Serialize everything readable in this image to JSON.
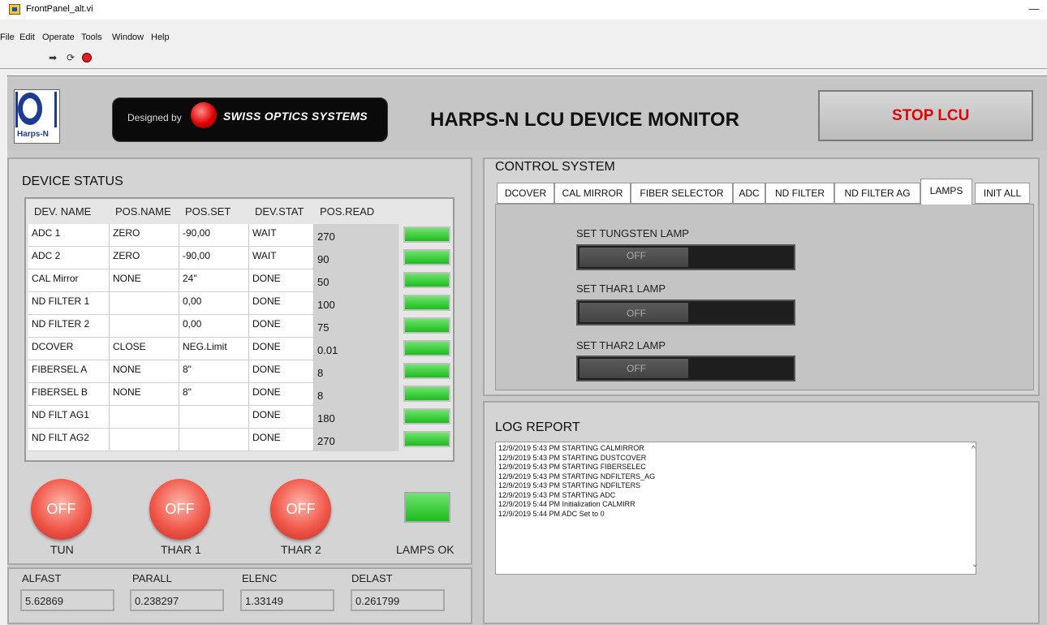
{
  "window": {
    "title": "FrontPanel_alt.vi",
    "minimize": "—"
  },
  "menu": [
    "File",
    "Edit",
    "Operate",
    "Tools",
    "Window",
    "Help"
  ],
  "toolbar": {
    "run_icon": "run-arrow-icon",
    "continuous_icon": "run-continuous-icon",
    "abort_icon": "abort-icon"
  },
  "header": {
    "logo_text": "Harps-N",
    "designed_by": "Designed by",
    "company": "SWISS OPTICS SYSTEMS",
    "title": "HARPS-N LCU DEVICE MONITOR",
    "stop_button": "STOP LCU"
  },
  "device_status": {
    "title": "DEVICE STATUS",
    "columns": [
      "DEV. NAME",
      "POS.NAME",
      "POS.SET",
      "DEV.STAT",
      "POS.READ"
    ],
    "rows": [
      [
        "ADC 1",
        "ZERO",
        "-90,00",
        "WAIT",
        "270"
      ],
      [
        "ADC 2",
        "ZERO",
        "-90,00",
        "WAIT",
        "90"
      ],
      [
        "CAL Mirror",
        "NONE",
        "24\"",
        "DONE",
        "50"
      ],
      [
        "ND FILTER 1",
        "",
        "0,00",
        "DONE",
        "100"
      ],
      [
        "ND FILTER 2",
        "",
        "0,00",
        "DONE",
        "75"
      ],
      [
        "DCOVER",
        "CLOSE",
        "NEG.Limit",
        "DONE",
        "0.01"
      ],
      [
        "FIBERSEL A",
        "NONE",
        "8\"",
        "DONE",
        "8"
      ],
      [
        "FIBERSEL B",
        "NONE",
        "8\"",
        "DONE",
        "8"
      ],
      [
        "ND FILT AG1",
        "",
        "",
        "DONE",
        "180"
      ],
      [
        "ND FILT AG2",
        "",
        "",
        "DONE",
        "270"
      ]
    ],
    "led_color": "#2ecc2e"
  },
  "lamps": {
    "tun": {
      "state": "OFF",
      "label": "TUN"
    },
    "thar1": {
      "state": "OFF",
      "label": "THAR 1"
    },
    "thar2": {
      "state": "OFF",
      "label": "THAR 2"
    },
    "ok_label": "LAMPS OK",
    "off_color": "#f0584a"
  },
  "coords": {
    "alfast": {
      "label": "ALFAST",
      "value": "5.62869"
    },
    "parall": {
      "label": "PARALL",
      "value": "0.238297"
    },
    "elenc": {
      "label": "ELENC",
      "value": "1.33149"
    },
    "delast": {
      "label": "DELAST",
      "value": "0.261799"
    }
  },
  "control": {
    "title": "CONTROL SYSTEM",
    "tabs": [
      "DCOVER",
      "CAL MIRROR",
      "FIBER SELECTOR",
      "ADC",
      "ND FILTER",
      "ND FILTER AG",
      "LAMPS",
      "INIT ALL"
    ],
    "active_tab": "LAMPS",
    "tungsten": {
      "label": "SET TUNGSTEN LAMP",
      "state": "OFF"
    },
    "thar1": {
      "label": "SET THAR1 LAMP",
      "state": "OFF"
    },
    "thar2": {
      "label": "SET THAR2 LAMP",
      "state": "OFF"
    }
  },
  "log": {
    "title": "LOG REPORT",
    "lines": [
      "12/9/2019 5:43 PM STARTING CALMIRROR",
      "12/9/2019 5:43 PM STARTING DUSTCOVER",
      "12/9/2019 5:43 PM STARTING FIBERSELEC",
      "12/9/2019 5:43 PM STARTING NDFILTERS_AG",
      "12/9/2019 5:43 PM STARTING NDFILTERS",
      "12/9/2019 5:43 PM STARTING ADC",
      "12/9/2019 5:44 PM Initialization CALMIRR",
      "12/9/2019 5:44 PM ADC Set to 0"
    ]
  }
}
